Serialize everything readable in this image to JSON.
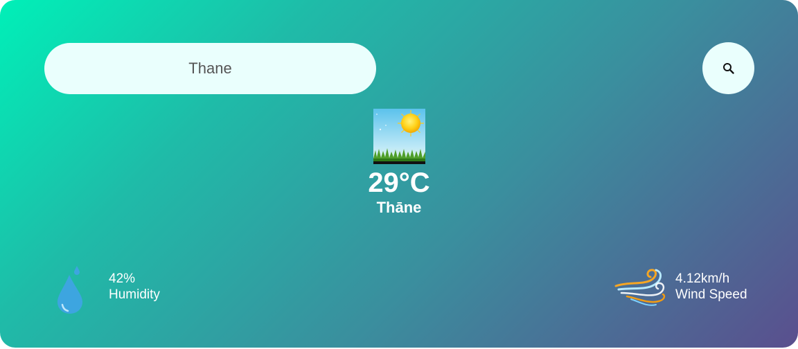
{
  "search": {
    "value": "Thane",
    "button_icon": "search-icon"
  },
  "weather": {
    "icon": "sunny-weather-icon",
    "temperature": "29°C",
    "city": "Thāne"
  },
  "humidity": {
    "icon": "water-drop-icon",
    "value": "42%",
    "label": "Humidity"
  },
  "wind": {
    "icon": "wind-icon",
    "value": "4.12km/h",
    "label": "Wind Speed"
  },
  "colors": {
    "gradient_start": "#00f0b8",
    "gradient_end": "#5a4f8e",
    "input_background": "#eafffd"
  }
}
